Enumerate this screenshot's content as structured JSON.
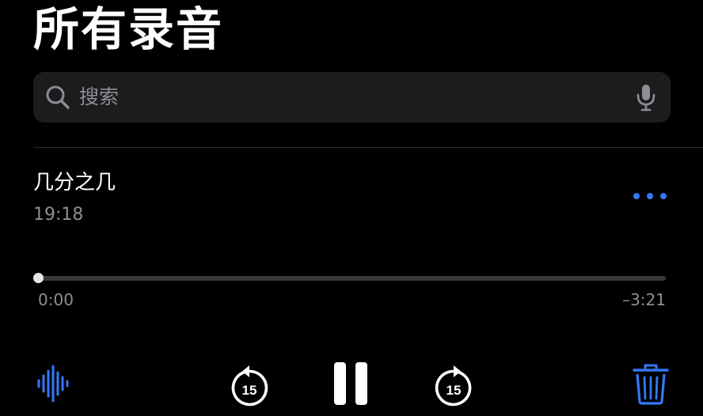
{
  "header": {
    "title": "所有录音"
  },
  "search": {
    "placeholder": "搜索",
    "search_icon": "magnifying-glass",
    "mic_icon": "microphone"
  },
  "recording": {
    "title": "几分之几",
    "time": "19:18",
    "more_icon": "ellipsis"
  },
  "player": {
    "elapsed": "0:00",
    "remaining": "–3:21",
    "progress_fraction": 0,
    "skip_back_seconds": "15",
    "skip_forward_seconds": "15",
    "state": "playing"
  },
  "toolbar": {
    "waveform_icon": "waveform",
    "pause_icon": "pause",
    "trash_icon": "trash"
  },
  "colors": {
    "background": "#000000",
    "accent": "#3478f6",
    "secondary_text": "#8e8e93",
    "search_field": "#1c1c1e"
  }
}
